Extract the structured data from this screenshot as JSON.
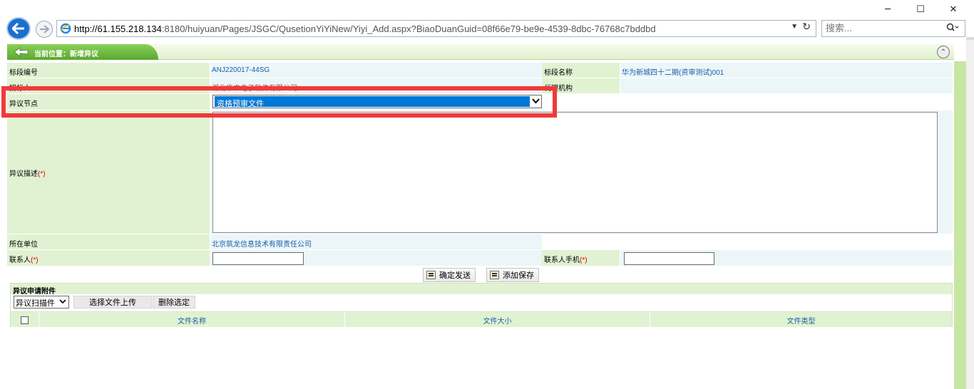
{
  "browser": {
    "url_host": "http://61.155.218.134",
    "url_rest": ":8180/huiyuan/Pages/JSGC/QusetionYiYiNew/Yiyi_Add.aspx?BiaoDuanGuid=08f66e79-be9e-4539-8dbc-76768c7bddbd",
    "search_placeholder": "搜索...",
    "window_controls": [
      "─",
      "☐",
      "✕"
    ]
  },
  "breadcrumb": {
    "label": "当前位置：新增异议"
  },
  "form": {
    "section_no_label": "标段编号",
    "section_no_value": "ANJ220017-44SG",
    "section_name_label": "标段名称",
    "section_name_value": "华为新城四十二期(资审测试)001",
    "tenderer_label": "招标人",
    "tenderer_value": "湖北华中电子软件有限公司",
    "agency_label": "代理机构",
    "agency_value": "",
    "node_label": "异议节点",
    "node_value": "资格预审文件",
    "desc_label": "异议描述",
    "required_mark": "(*)",
    "unit_label": "所在单位",
    "unit_value": "北京筑龙信息技术有限责任公司",
    "contact_label": "联系人",
    "contact_value": "",
    "phone_label": "联系人手机",
    "phone_value": ""
  },
  "actions": {
    "submit_label": "确定发送",
    "save_label": "添加保存"
  },
  "attachments": {
    "title": "异议申请附件",
    "type_selected": "异议扫描件",
    "upload_label": "选择文件上传",
    "delete_label": "删除选定",
    "columns": [
      "文件名称",
      "文件大小",
      "文件类型"
    ]
  },
  "colors": {
    "accent_green": "#5aa82f",
    "label_bg": "#e1f2d2",
    "value_bg": "#ecf6f9",
    "highlight_red": "#f03a3a",
    "selection_blue": "#0078d7"
  }
}
